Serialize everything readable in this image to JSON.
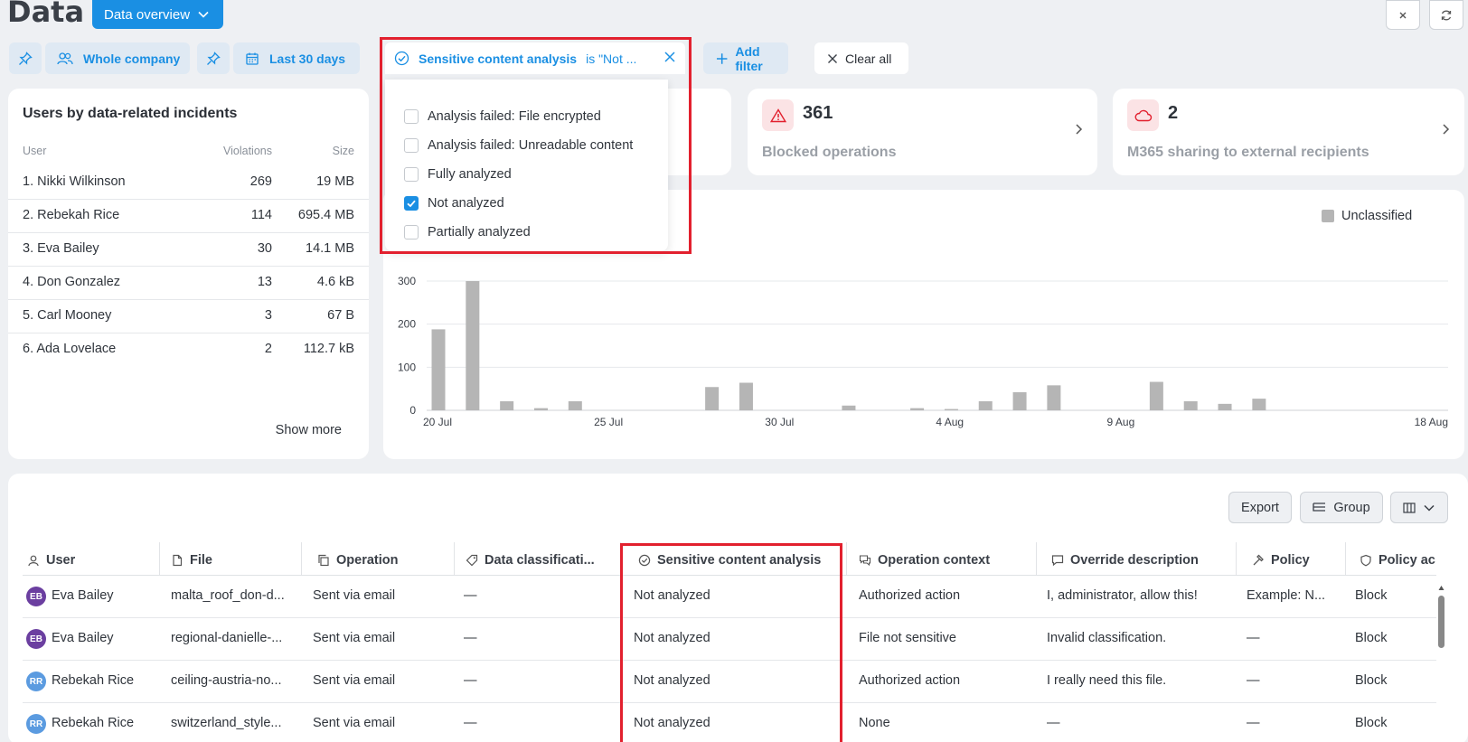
{
  "header": {
    "title": "Data",
    "view_button": "Data overview"
  },
  "filters": {
    "scope": "Whole company",
    "period": "Last 30 days",
    "sensitive": {
      "label": "Sensitive content analysis",
      "value": "is \"Not ..."
    },
    "add_filter": "Add filter",
    "clear_all": "Clear all"
  },
  "dropdown": {
    "options": [
      {
        "label": "Analysis failed: File encrypted",
        "checked": false
      },
      {
        "label": "Analysis failed: Unreadable content",
        "checked": false
      },
      {
        "label": "Fully analyzed",
        "checked": false
      },
      {
        "label": "Not analyzed",
        "checked": true
      },
      {
        "label": "Partially analyzed",
        "checked": false
      }
    ]
  },
  "users_card": {
    "title": "Users by data-related incidents",
    "headers": {
      "user": "User",
      "violations": "Violations",
      "size": "Size"
    },
    "rows": [
      {
        "name": "1. Nikki Wilkinson",
        "violations": "269",
        "size": "19 MB"
      },
      {
        "name": "2. Rebekah Rice",
        "violations": "114",
        "size": "695.4 MB"
      },
      {
        "name": "3. Eva Bailey",
        "violations": "30",
        "size": "14.1 MB"
      },
      {
        "name": "4. Don Gonzalez",
        "violations": "13",
        "size": "4.6 kB"
      },
      {
        "name": "5. Carl Mooney",
        "violations": "3",
        "size": "67 B"
      },
      {
        "name": "6. Ada Lovelace",
        "violations": "2",
        "size": "112.7 kB"
      }
    ],
    "show_more": "Show more"
  },
  "stats": {
    "blocked": {
      "value": "361",
      "label": "Blocked operations",
      "icon": "warning-triangle-icon"
    },
    "m365": {
      "value": "2",
      "label": "M365 sharing to external recipients",
      "icon": "cloud-icon"
    }
  },
  "colors": {
    "accent": "#1a8fe3",
    "highlight": "#e2202e",
    "bar": "#b5b5b5"
  },
  "chart_data": {
    "type": "bar",
    "series": [
      {
        "name": "Unclassified",
        "color": "#b5b5b5"
      }
    ],
    "x_ticks": [
      "20 Jul",
      "25 Jul",
      "30 Jul",
      "4 Aug",
      "9 Aug",
      "18 Aug"
    ],
    "x_tick_days": [
      0,
      5,
      10,
      15,
      20,
      29
    ],
    "y_ticks": [
      "0",
      "100",
      "200",
      "300"
    ],
    "ylim": [
      0,
      300
    ],
    "bars": [
      {
        "day": 0,
        "value": 188
      },
      {
        "day": 1,
        "value": 300
      },
      {
        "day": 2,
        "value": 21
      },
      {
        "day": 3,
        "value": 5
      },
      {
        "day": 4,
        "value": 21
      },
      {
        "day": 8,
        "value": 54
      },
      {
        "day": 9,
        "value": 64
      },
      {
        "day": 12,
        "value": 11
      },
      {
        "day": 14,
        "value": 5
      },
      {
        "day": 15,
        "value": 3
      },
      {
        "day": 16,
        "value": 21
      },
      {
        "day": 17,
        "value": 42
      },
      {
        "day": 18,
        "value": 58
      },
      {
        "day": 21,
        "value": 66
      },
      {
        "day": 22,
        "value": 21
      },
      {
        "day": 23,
        "value": 15
      },
      {
        "day": 24,
        "value": 27
      }
    ]
  },
  "table": {
    "buttons": {
      "export": "Export",
      "group": "Group"
    },
    "columns": [
      "User",
      "File",
      "Operation",
      "Data classificati...",
      "Sensitive content analysis",
      "Operation context",
      "Override description",
      "Policy",
      "Policy ac"
    ],
    "rows": [
      {
        "initials": "EB",
        "avatar_color": "#6b3fa0",
        "user": "Eva Bailey",
        "file": "malta_roof_don-d...",
        "operation": "Sent via email",
        "classification": "—",
        "sensitive": "Not analyzed",
        "context": "Authorized action",
        "override": "I, administrator, allow this!",
        "policy": "Example: N...",
        "action": "Block"
      },
      {
        "initials": "EB",
        "avatar_color": "#6b3fa0",
        "user": "Eva Bailey",
        "file": "regional-danielle-...",
        "operation": "Sent via email",
        "classification": "—",
        "sensitive": "Not analyzed",
        "context": "File not sensitive",
        "override": "Invalid classification.",
        "policy": "—",
        "action": "Block"
      },
      {
        "initials": "RR",
        "avatar_color": "#5b9be0",
        "user": "Rebekah Rice",
        "file": "ceiling-austria-no...",
        "operation": "Sent via email",
        "classification": "—",
        "sensitive": "Not analyzed",
        "context": "Authorized action",
        "override": "I really need this file.",
        "policy": "—",
        "action": "Block"
      },
      {
        "initials": "RR",
        "avatar_color": "#5b9be0",
        "user": "Rebekah Rice",
        "file": "switzerland_style...",
        "operation": "Sent via email",
        "classification": "—",
        "sensitive": "Not analyzed",
        "context": "None",
        "override": "—",
        "policy": "—",
        "action": "Block"
      }
    ]
  }
}
